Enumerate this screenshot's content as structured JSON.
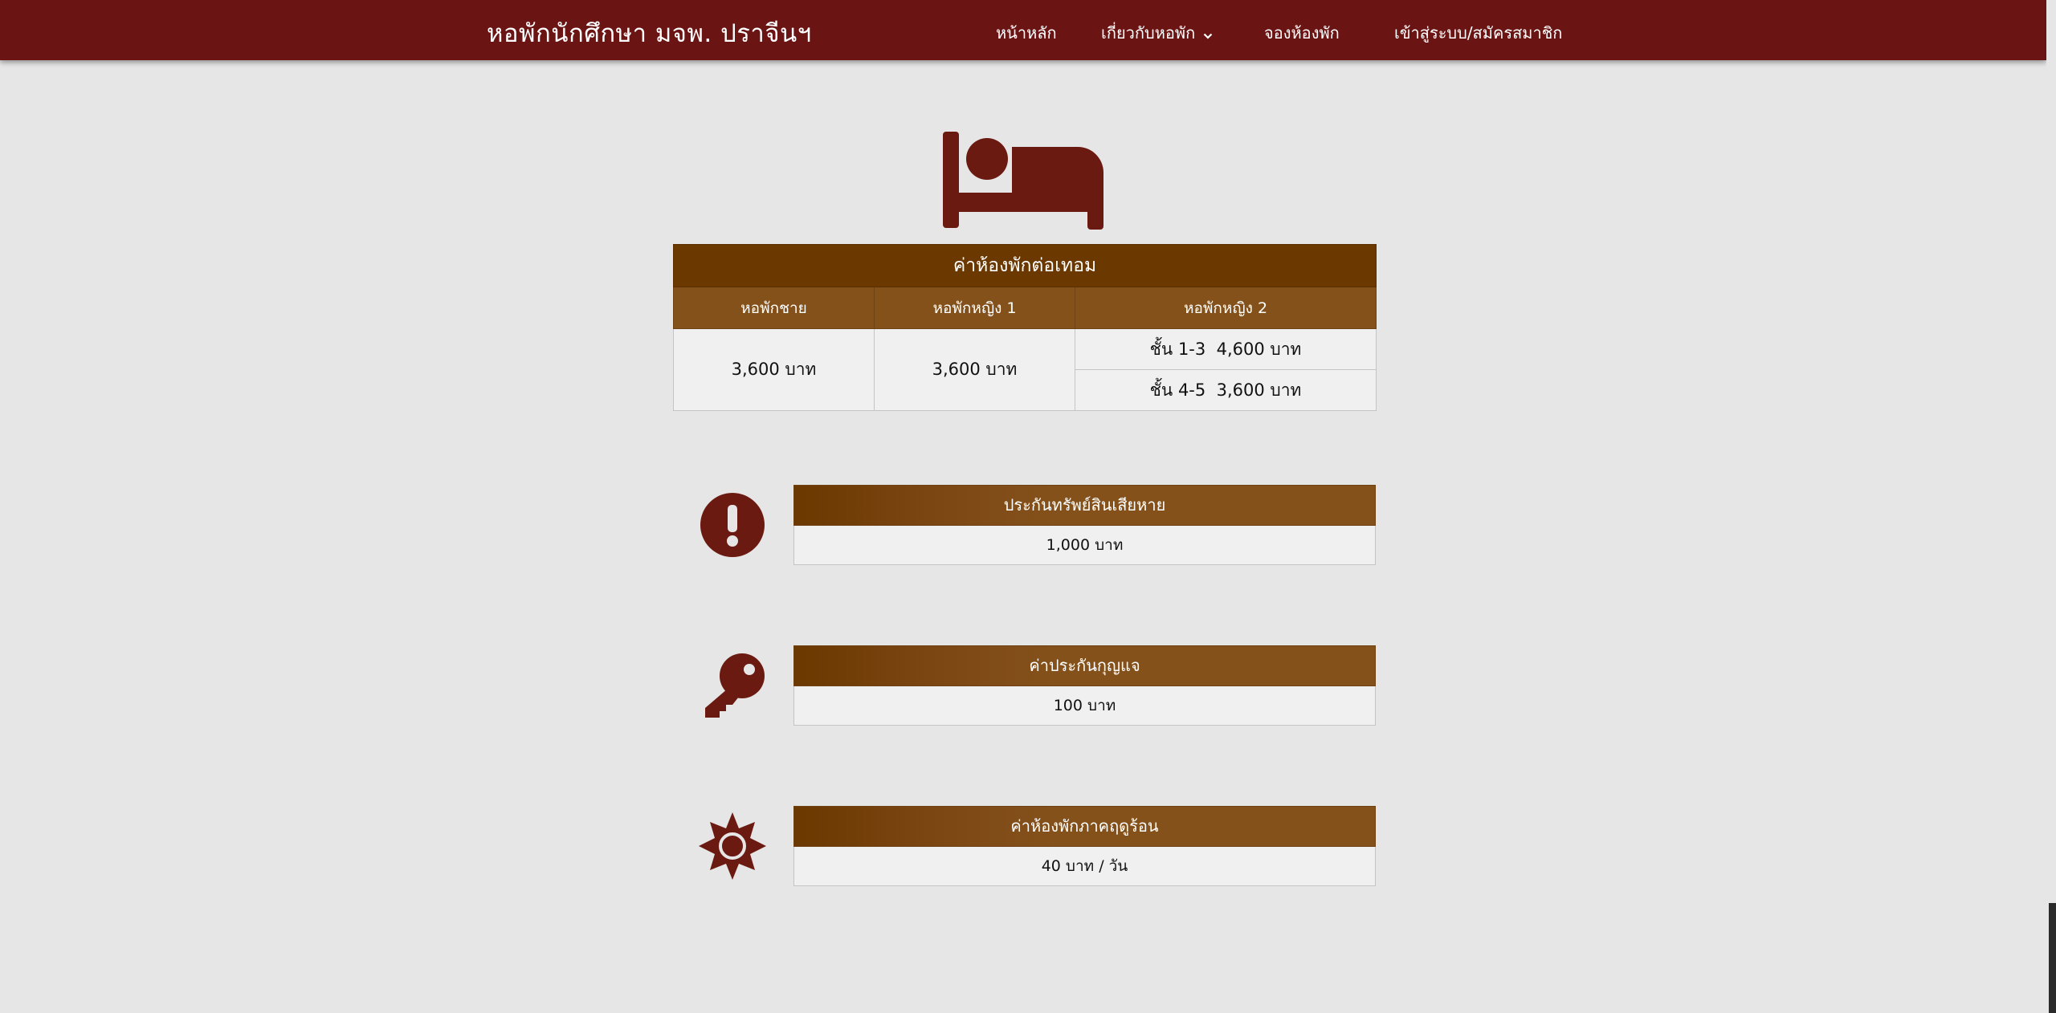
{
  "navbar": {
    "brand": "หอพักนักศึกษา มจพ. ปราจีนฯ",
    "items": [
      {
        "label": "หน้าหลัก"
      },
      {
        "label": "เกี่ยวกับหอพัก",
        "has_dropdown": true
      },
      {
        "label": "จองห้องพัก"
      },
      {
        "label": "เข้าสู่ระบบ/สมัครสมาชิก"
      }
    ]
  },
  "rates": {
    "title": "ค่าห้องพักต่อเทอม",
    "columns": [
      "หอพักชาย",
      "หอพักหญิง 1",
      "หอพักหญิง 2"
    ],
    "male_price": "3,600 บาท",
    "female1_price": "3,600 บาท",
    "female2": [
      {
        "floors": "ชั้น 1-3",
        "price": "4,600 บาท"
      },
      {
        "floors": "ชั้น 4-5",
        "price": "3,600 บาท"
      }
    ]
  },
  "fees": [
    {
      "icon": "exclamation-circle-icon",
      "title": "ประกันทรัพย์สินเสียหาย",
      "value": "1,000 บาท"
    },
    {
      "icon": "key-icon",
      "title": "ค่าประกันกุญแจ",
      "value": "100 บาท"
    },
    {
      "icon": "sun-icon",
      "title": "ค่าห้องพักภาคฤดูร้อน",
      "value": "40 บาท / วัน"
    }
  ],
  "colors": {
    "navbar": "#6b1414",
    "icon": "#6b1a12",
    "header_dark": "#6b3800",
    "header_light": "#84511b",
    "background": "#e6e6e6"
  }
}
